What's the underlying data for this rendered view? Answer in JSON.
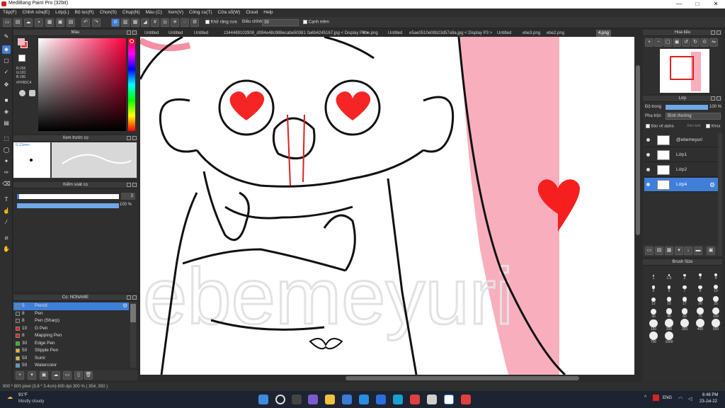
{
  "window": {
    "title": "MediBang Paint Pro (32bit)",
    "minimize": "—",
    "maximize": "□",
    "close": "✕"
  },
  "menu": [
    "Tệp(F)",
    "Chỉnh sửa(E)",
    "Lớp(L)",
    "Bộ lọc(R)",
    "Chọn(S)",
    "Chụp(N)",
    "Màu (C)",
    "Xem(V)",
    "Công cụ(T)",
    "Cửa sổ(W)",
    "Cloud",
    "Help"
  ],
  "toolbar": {
    "antialias_label": "Khử răng cưa",
    "correction_label": "Điều chỉnh",
    "correction_value": "39",
    "edge_label": "Cạnh mềm"
  },
  "tabs": [
    {
      "label": "Untitled"
    },
    {
      "label": "Untitled"
    },
    {
      "label": "Untitled"
    },
    {
      "label": "z344469102908_d094e48c988ecabe50381 0a6b4245167.jpg < Display P3 >"
    },
    {
      "label": "ebe.png"
    },
    {
      "label": "Untitled"
    },
    {
      "label": "e5ae0510e08b23d57a9a.jpg < Display P3 >"
    },
    {
      "label": "Untitled"
    },
    {
      "label": "ebe3.png"
    },
    {
      "label": "ebe2.png"
    },
    {
      "label": "4.png"
    }
  ],
  "color_panel": {
    "title": "Màu",
    "r": "R:255",
    "g": "G:181",
    "b": "B:196",
    "hex": "#FFB5C4",
    "colors": {
      "primary": "#ff3a3a",
      "secondary": "#ffffff",
      "brand": "#ffb5c4"
    }
  },
  "brush_preview": {
    "title": "Xem trước cọ",
    "size": "0.13mm"
  },
  "brush_control": {
    "title": "Kiểm soát cọ",
    "size_value": "3",
    "opacity_value": "100 %",
    "size_fraction": 0.02,
    "opacity_fraction": 1.0
  },
  "brush_list": {
    "title": "Cọ: NONAME",
    "items": [
      {
        "size": "5",
        "name": "Pencil",
        "color": "#3f7fd8"
      },
      {
        "size": "8",
        "name": "Pen",
        "color": "#3a3a3a"
      },
      {
        "size": "8",
        "name": "Pen (Sharp)",
        "color": "#3a3a3a"
      },
      {
        "size": "10",
        "name": "G Pen",
        "color": "#e02020"
      },
      {
        "size": "8",
        "name": "Mapping Pen",
        "color": "#e02020"
      },
      {
        "size": "30",
        "name": "Edge Pen",
        "color": "#20c020"
      },
      {
        "size": "50",
        "name": "Stipple Pen",
        "color": "#e0c020"
      },
      {
        "size": "50",
        "name": "Sumi",
        "color": "#e0c020"
      },
      {
        "size": "50",
        "name": "Watercolor",
        "color": "#3fa0e0"
      }
    ]
  },
  "navigator": {
    "title": "Hoa tiêu"
  },
  "layer_panel": {
    "title": "Lớp",
    "opacity_label": "Độ trong",
    "opacity_value": "100 %",
    "opacity_fraction": 1.0,
    "blend_label": "Pha trộn",
    "blend_value": "Bình thường",
    "protect_alpha": "Bảo vệ alpha",
    "clipping": "Xén bớt",
    "lock": "Khóa",
    "layers": [
      {
        "name": "@ebemeyuri",
        "active": false
      },
      {
        "name": "Lớp1",
        "active": false
      },
      {
        "name": "Lớp2",
        "active": false
      },
      {
        "name": "Lớp4",
        "active": true
      }
    ]
  },
  "brush_size": {
    "title": "Brush Size",
    "sizes": [
      "1",
      "1.5",
      "2",
      "3",
      "4",
      "5",
      "6",
      "7",
      "8",
      "10",
      "12",
      "15",
      "17",
      "20",
      "25",
      "30",
      "40",
      "50",
      "70",
      "100",
      "150",
      "200",
      "300",
      "400",
      "500",
      "700",
      "1000"
    ]
  },
  "status": {
    "text": "900 * 800 pixel  (3.8 * 3.4cm)  600 dpi  300 %  ( 354, 350 )"
  },
  "taskbar": {
    "weather_temp": "91°F",
    "weather_desc": "Mostly cloudy",
    "lang": "ENG",
    "time": "6:48 PM",
    "date": "23-Jul-22"
  },
  "canvas": {
    "watermark": "ebemeyuri"
  }
}
